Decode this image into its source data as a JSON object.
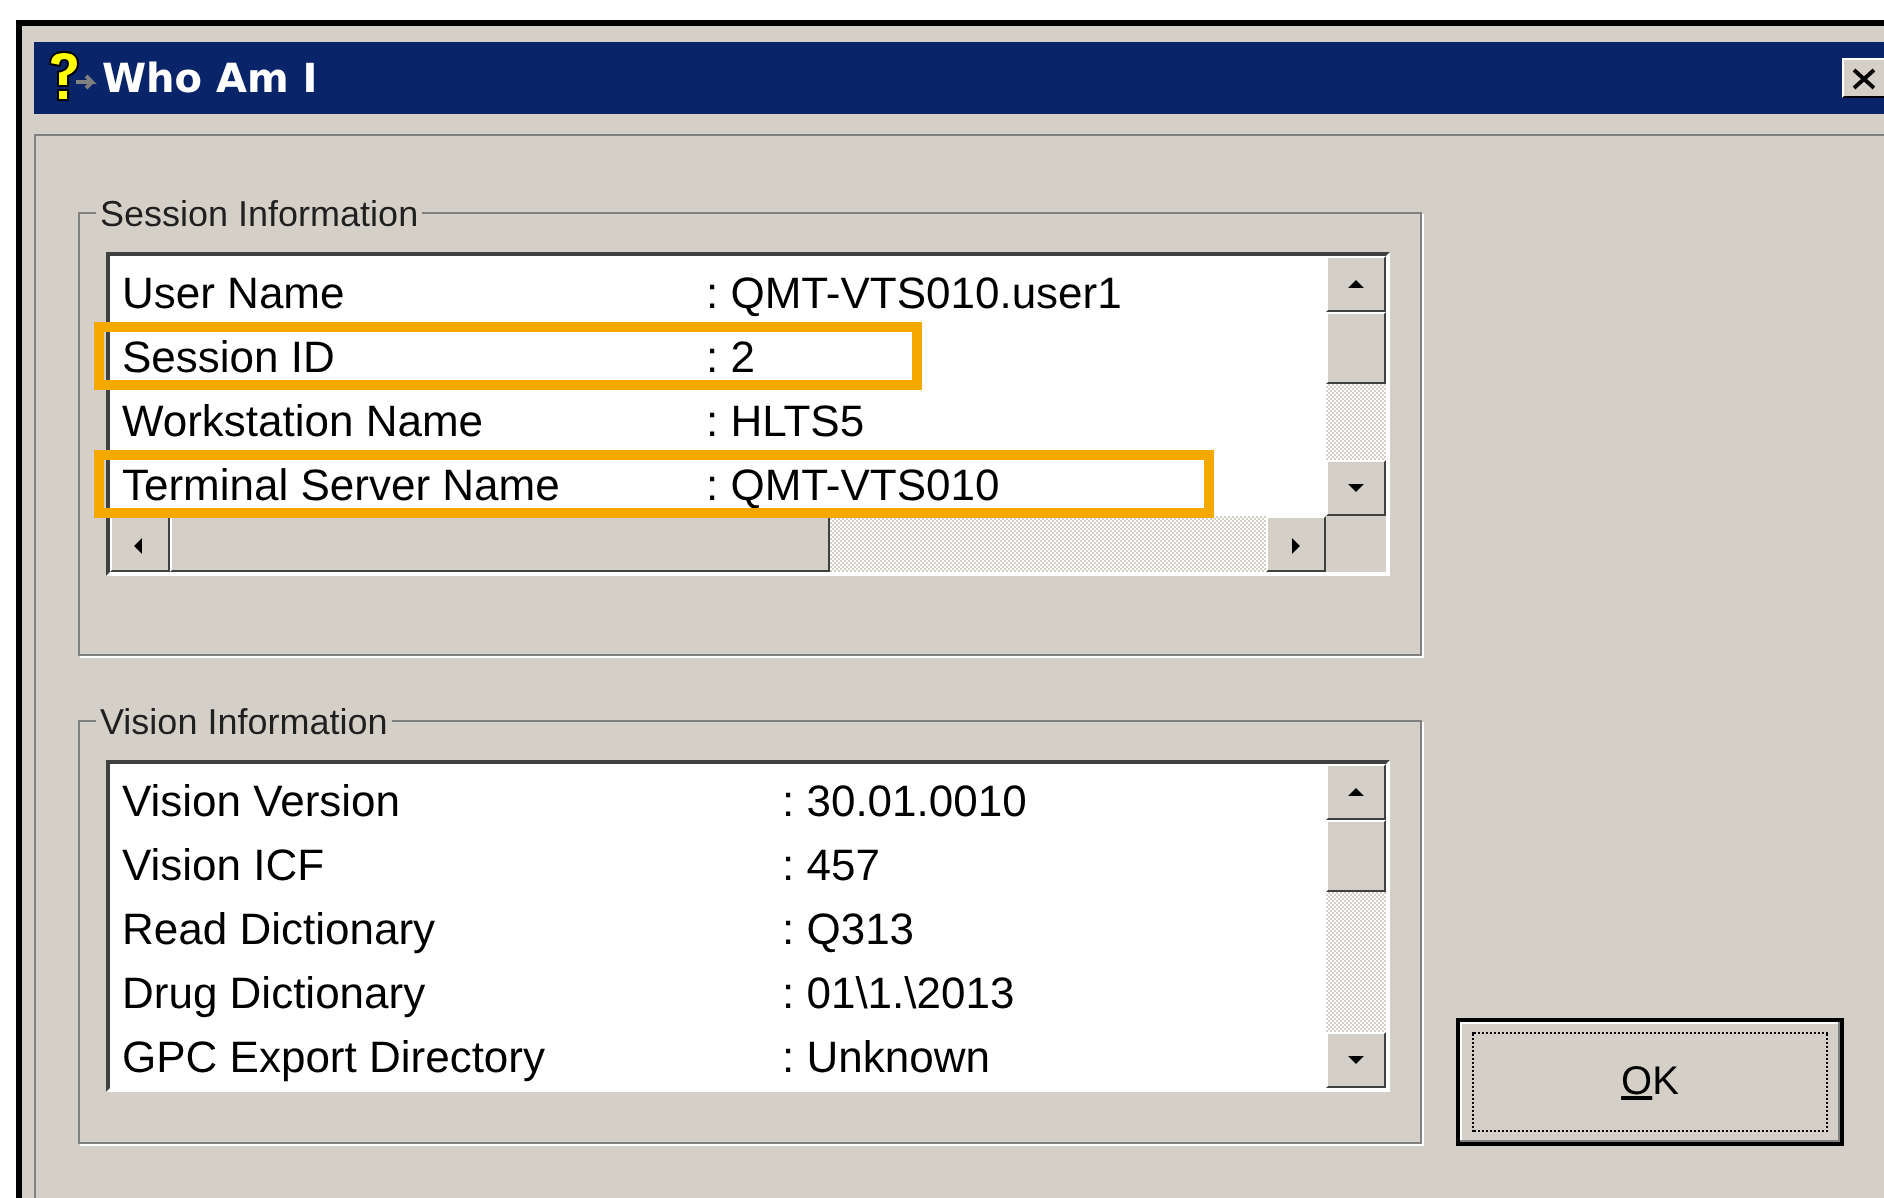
{
  "window": {
    "title": "Who Am I"
  },
  "session_information": {
    "title": "Session Information",
    "rows": [
      {
        "label": "User Name",
        "value": ": QMT-VTS010.user1",
        "highlighted": false
      },
      {
        "label": "Session ID",
        "value": ": 2",
        "highlighted": true
      },
      {
        "label": "Workstation Name",
        "value": ": HLTS5",
        "highlighted": false
      },
      {
        "label": "Terminal Server Name",
        "value": ": QMT-VTS010",
        "highlighted": true
      }
    ]
  },
  "vision_information": {
    "title": "Vision Information",
    "rows": [
      {
        "label": "Vision Version",
        "value": ": 30.01.0010"
      },
      {
        "label": "Vision ICF",
        "value": ": 457"
      },
      {
        "label": "Read Dictionary",
        "value": ": Q313"
      },
      {
        "label": "Drug Dictionary",
        "value": ": 01\\1.\\2013"
      },
      {
        "label": "GPC Export Directory",
        "value": ": Unknown"
      }
    ]
  },
  "buttons": [
    {
      "label": "OK"
    }
  ]
}
